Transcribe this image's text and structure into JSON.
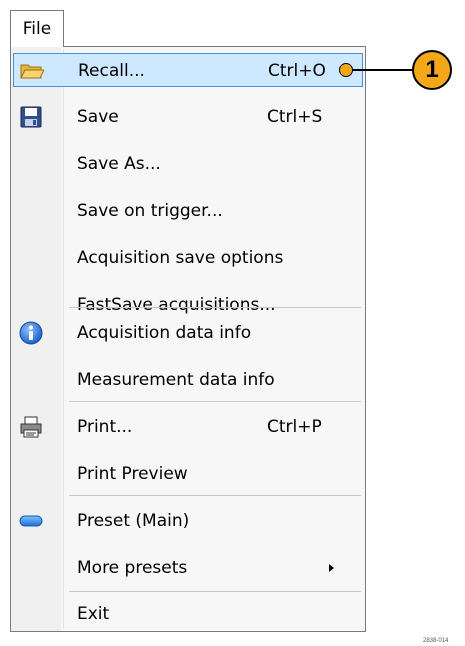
{
  "menu_title": "File",
  "items": [
    {
      "label": "Recall...",
      "shortcut": "Ctrl+O",
      "icon": "folder-open-icon",
      "highlighted": true
    },
    {
      "label": "Save",
      "shortcut": "Ctrl+S",
      "icon": "floppy-disk-icon"
    },
    {
      "label": "Save As..."
    },
    {
      "label": "Save on trigger..."
    },
    {
      "label": "Acquisition save options"
    },
    {
      "label": "FastSave acquisitions..."
    },
    {
      "label": "Acquisition data info",
      "icon": "info-icon"
    },
    {
      "label": "Measurement data info"
    },
    {
      "label": "Print...",
      "shortcut": "Ctrl+P",
      "icon": "printer-icon"
    },
    {
      "label": "Print Preview"
    },
    {
      "label": "Preset (Main)",
      "icon": "preset-icon"
    },
    {
      "label": "More presets",
      "submenu": true
    },
    {
      "label": "Exit"
    }
  ],
  "callout": {
    "number": "1"
  },
  "figure_code": "2838-014",
  "colors": {
    "highlight": "#cde8ff",
    "highlight_border": "#4a90d9",
    "callout": "#f2a818"
  }
}
